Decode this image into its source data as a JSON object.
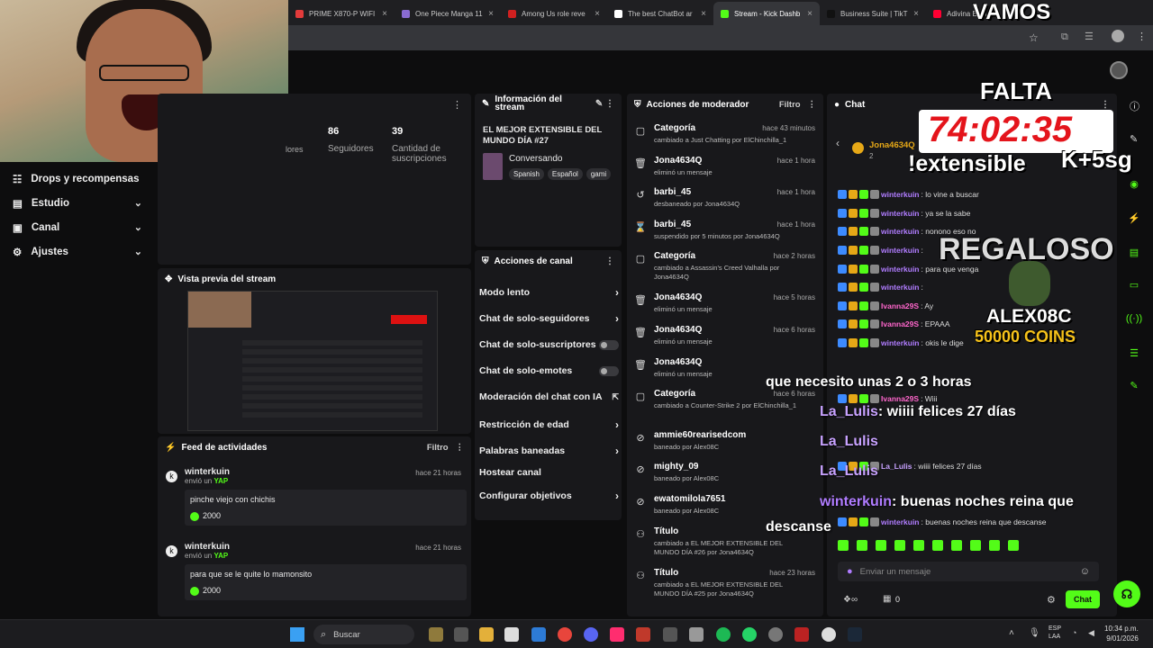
{
  "browser": {
    "tabs": [
      {
        "label": "PRIME X870-P WIFI",
        "color": "#e23b3b",
        "active": false
      },
      {
        "label": "One Piece Manga 11",
        "color": "#8a6bd1",
        "active": false
      },
      {
        "label": "Among Us role reve",
        "color": "#d02020",
        "active": false
      },
      {
        "label": "The best ChatBot ar",
        "color": "#ffffff",
        "active": false
      },
      {
        "label": "Stream - Kick Dashb",
        "color": "#53fc18",
        "active": true
      },
      {
        "label": "Business Suite | TikT",
        "color": "#111111",
        "active": false
      },
      {
        "label": "Adivina El In",
        "color": "#ff0033",
        "active": false
      }
    ]
  },
  "sidebar": {
    "items": [
      {
        "label": "Drops y recompensas",
        "icon": "drops-icon",
        "chevron": false
      },
      {
        "label": "Estudio",
        "icon": "studio-icon",
        "chevron": true
      },
      {
        "label": "Canal",
        "icon": "channel-icon",
        "chevron": true
      },
      {
        "label": "Ajustes",
        "icon": "gear-icon",
        "chevron": true
      }
    ]
  },
  "stats": {
    "items": [
      {
        "label": "lores",
        "value": ""
      },
      {
        "label": "Seguidores",
        "value": "86"
      },
      {
        "label": "Cantidad de suscripciones",
        "value": "39"
      }
    ]
  },
  "stream_info": {
    "header": "Información del stream",
    "title": "EL MEJOR EXTENSIBLE DEL MUNDO DÍA #27",
    "category": "Conversando",
    "tags": [
      "Spanish",
      "Español",
      "gami"
    ]
  },
  "preview": {
    "header": "Vista previa del stream"
  },
  "feed": {
    "header": "Feed de actividades",
    "filter": "Filtro",
    "items": [
      {
        "user": "winterkuin",
        "action": "envió un",
        "item": "YAP",
        "time": "hace 21 horas",
        "message": "pinche viejo con chichis",
        "amount": "2000"
      },
      {
        "user": "winterkuin",
        "action": "envió un",
        "item": "YAP",
        "time": "hace 21 horas",
        "message": "para que se le quite lo mamonsito",
        "amount": "2000"
      }
    ]
  },
  "channel_actions": {
    "header": "Acciones de canal",
    "items": [
      {
        "label": "Modo lento",
        "kind": "chevron"
      },
      {
        "label": "Chat de solo-seguidores",
        "kind": "chevron"
      },
      {
        "label": "Chat de solo-suscriptores",
        "kind": "toggle"
      },
      {
        "label": "Chat de solo-emotes",
        "kind": "toggle"
      },
      {
        "label": "Moderación del chat con IA",
        "kind": "external"
      },
      {
        "label": "Restricción de edad",
        "kind": "chevron"
      },
      {
        "label": "Palabras baneadas",
        "kind": "chevron"
      },
      {
        "label": "Hostear canal",
        "kind": "none"
      },
      {
        "label": "Configurar objetivos",
        "kind": "chevron"
      }
    ]
  },
  "mod_actions": {
    "header": "Acciones de moderador",
    "filter": "Filtro",
    "items": [
      {
        "icon": "category-icon",
        "who": "Categoría",
        "when": "hace 43 minutos",
        "detail": "cambiado a Just Chatting por ElChinchilla_1"
      },
      {
        "icon": "trash-icon",
        "who": "Jona4634Q",
        "when": "hace 1 hora",
        "detail": "eliminó un mensaje"
      },
      {
        "icon": "unban-icon",
        "who": "barbi_45",
        "when": "hace 1 hora",
        "detail": "desbaneado por Jona4634Q"
      },
      {
        "icon": "hourglass-icon",
        "who": "barbi_45",
        "when": "hace 1 hora",
        "detail": "suspendido por 5 minutos por Jona4634Q"
      },
      {
        "icon": "category-icon",
        "who": "Categoría",
        "when": "hace 2 horas",
        "detail": "cambiado a Assassin's Creed Valhalla por Jona4634Q"
      },
      {
        "icon": "trash-icon",
        "who": "Jona4634Q",
        "when": "hace 5 horas",
        "detail": "eliminó un mensaje"
      },
      {
        "icon": "trash-icon",
        "who": "Jona4634Q",
        "when": "hace 6 horas",
        "detail": "eliminó un mensaje"
      },
      {
        "icon": "trash-icon",
        "who": "Jona4634Q",
        "when": "",
        "detail": "eliminó un mensaje"
      },
      {
        "icon": "category-icon",
        "who": "Categoría",
        "when": "hace 6 horas",
        "detail": "cambiado a Counter-Strike 2 por ElChinchilla_1"
      },
      {
        "icon": "ban-icon",
        "who": "ammie60rearisedcom",
        "when": "",
        "detail": "baneado por Alex08C"
      },
      {
        "icon": "ban-icon",
        "who": "mighty_09",
        "when": "",
        "detail": "baneado por Alex08C"
      },
      {
        "icon": "ban-icon",
        "who": "ewatomilola7651",
        "when": "",
        "detail": "baneado por Alex08C"
      },
      {
        "icon": "title-icon",
        "who": "Título",
        "when": "",
        "detail": "cambiado a EL MEJOR EXTENSIBLE DEL MUNDO DÍA #26 por Jona4634Q"
      },
      {
        "icon": "title-icon",
        "who": "Título",
        "when": "hace 23 horas",
        "detail": "cambiado a EL MEJOR EXTENSIBLE DEL MUNDO DÍA #25 por Jona4634Q"
      }
    ]
  },
  "chat": {
    "header": "Chat",
    "pinned_user": "Jona4634Q",
    "pinned_count": "2",
    "lines": [
      {
        "user": "winterkuin",
        "text": ": lo vine a buscar",
        "cls": "wk"
      },
      {
        "user": "winterkuin",
        "text": ": ya se la sabe",
        "cls": "wk"
      },
      {
        "user": "winterkuin",
        "text": ": nonono eso no",
        "cls": "wk"
      },
      {
        "user": "winterkuin",
        "text": ": ",
        "cls": "wk"
      },
      {
        "user": "winterkuin",
        "text": ": para que venga",
        "cls": "wk"
      },
      {
        "user": "winterkuin",
        "text": ":",
        "cls": "wk"
      },
      {
        "user": "Ivanna29S",
        "text": ": Ay",
        "cls": "iv"
      },
      {
        "user": "Ivanna29S",
        "text": ": EPAAA",
        "cls": "iv"
      },
      {
        "user": "winterkuin",
        "text": ": okis le dige",
        "cls": "wk"
      },
      {
        "user": "Ivanna29S",
        "text": ": Wiii",
        "cls": "iv"
      },
      {
        "user": "La_Lulis",
        "text": ": wiiii felices 27 días",
        "cls": "ll"
      },
      {
        "user": "winterkuin",
        "text": ": buenas noches reina que descanse",
        "cls": "wk"
      }
    ],
    "input_placeholder": "Enviar un mensaje",
    "send_label": "Chat",
    "points": "0"
  },
  "overlay": {
    "vamos": "VAMOS",
    "falta": "FALTA",
    "timer": "74:02:35",
    "extensible": "!extensible",
    "plus": "K+5sg",
    "regaloso": "REGALOSO",
    "gifter": "ALEX08C",
    "coins": "50000 COINS",
    "big1": "que necesito unas 2 o 3 horas",
    "big2user": "La_Lulis",
    "big2text": ": wiiii felices 27 días",
    "big3user": "La_Lulis",
    "big4user": "La_Lulis",
    "big5user": "winterkuin",
    "big5text": ": buenas noches reina que",
    "big6": "descanse"
  },
  "taskbar": {
    "search": "Buscar",
    "lang1": "ESP",
    "lang2": "LAA",
    "time": "10:34 p.m.",
    "date": "9/01/2026"
  }
}
